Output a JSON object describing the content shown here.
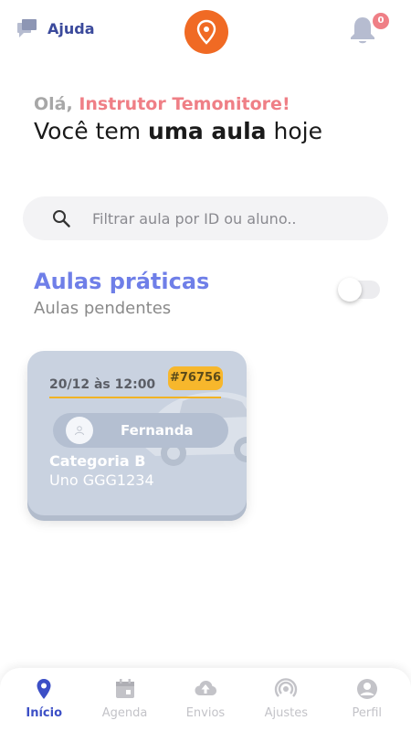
{
  "header": {
    "help_label": "Ajuda",
    "notification_count": "0",
    "logo_icon": "map-pin-icon"
  },
  "greeting": {
    "hello": "Olá, ",
    "name": "Instrutor Temonitore!",
    "line_prefix": "Você tem ",
    "line_bold": "uma aula",
    "line_suffix": " hoje"
  },
  "search": {
    "placeholder": "Filtrar aula por ID ou aluno..",
    "value": ""
  },
  "section": {
    "title": "Aulas práticas",
    "subtitle": "Aulas pendentes",
    "toggle_on": false
  },
  "lessons": [
    {
      "datetime": "20/12 às 12:00",
      "id": "#76756",
      "student": "Fernanda",
      "category": "Categoria B",
      "car": "Uno GGG1234"
    }
  ],
  "nav": [
    {
      "label": "Início",
      "icon": "location-pin-icon",
      "active": true
    },
    {
      "label": "Agenda",
      "icon": "calendar-icon",
      "active": false
    },
    {
      "label": "Envios",
      "icon": "cloud-upload-icon",
      "active": false
    },
    {
      "label": "Ajustes",
      "icon": "settings-signal-icon",
      "active": false
    },
    {
      "label": "Perfil",
      "icon": "account-icon",
      "active": false
    }
  ],
  "colors": {
    "accent": "#3c4fc6",
    "brand_orange": "#f06a24",
    "name_pink": "#ef7f86",
    "section_blue": "#6f7fe8",
    "id_badge": "#f7b72c"
  }
}
